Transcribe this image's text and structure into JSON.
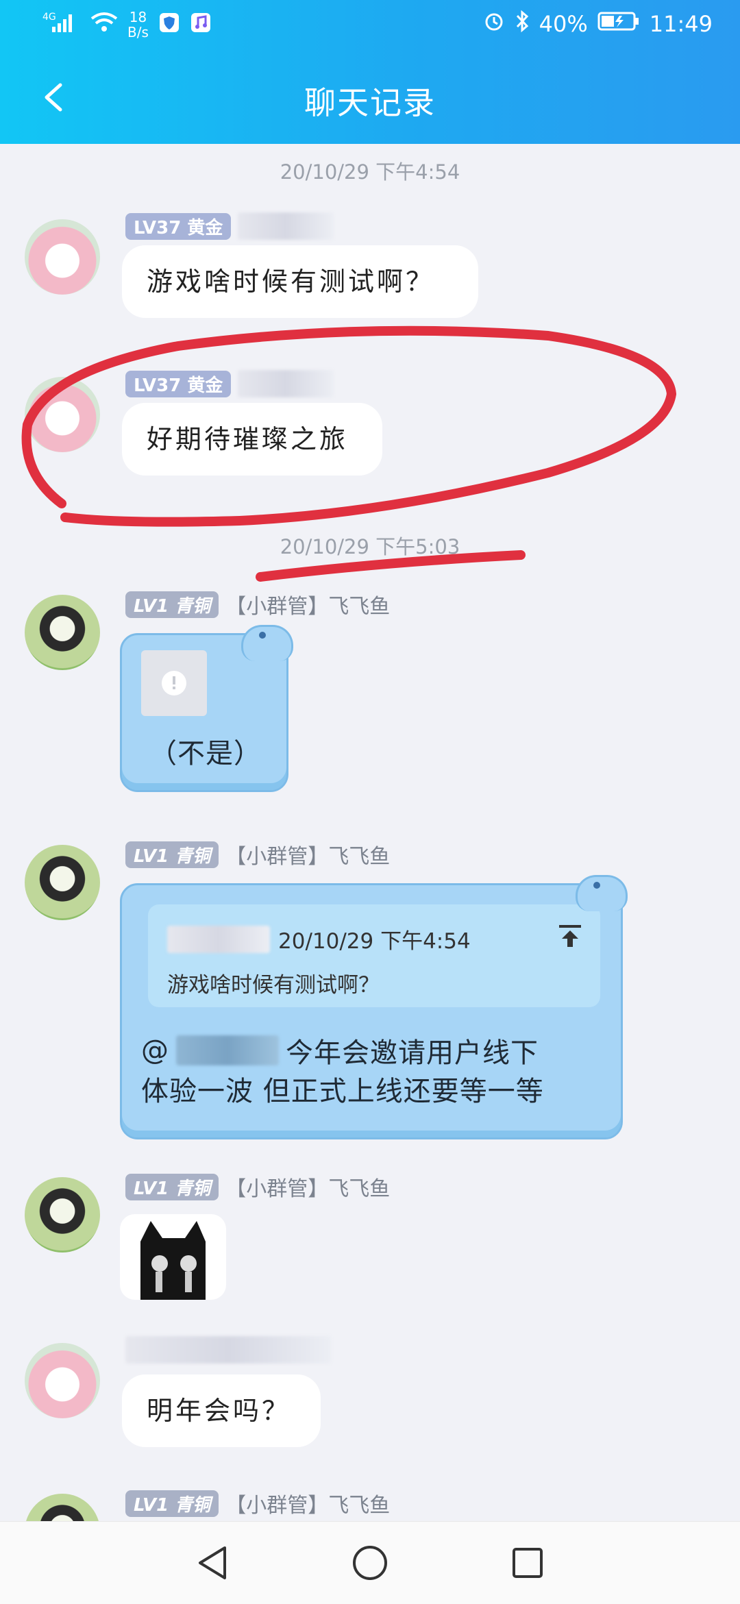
{
  "status_bar": {
    "network": "4G",
    "speed_value": "18",
    "speed_unit": "B/s",
    "battery": "40%",
    "time": "11:49"
  },
  "header": {
    "title": "聊天记录"
  },
  "timestamps": [
    "20/10/29 下午4:54",
    "20/10/29 下午5:03"
  ],
  "messages": [
    {
      "level": "LV37",
      "rank": "黄金",
      "text": "游戏啥时候有测试啊？"
    },
    {
      "level": "LV37",
      "rank": "黄金",
      "text": "好期待璀璨之旅"
    },
    {
      "level": "LV1",
      "rank": "青铜",
      "role": "【小群管】飞飞鱼",
      "text": "（不是）"
    },
    {
      "level": "LV1",
      "rank": "青铜",
      "role": "【小群管】飞飞鱼",
      "quote_time": "20/10/29 下午4:54",
      "quote_text": "游戏啥时候有测试啊？",
      "reply_line1": "今年会邀请用户线下",
      "reply_line2": "体验一波 但正式上线还要等一等"
    },
    {
      "level": "LV1",
      "rank": "青铜",
      "role": "【小群管】飞飞鱼"
    },
    {
      "text": "明年会吗？"
    },
    {
      "level": "LV1",
      "rank": "青铜",
      "role": "【小群管】飞飞鱼"
    }
  ],
  "colors": {
    "header": "#1ea9f1",
    "annotation": "#e0303f",
    "bubble_blue": "#a7d5f6"
  },
  "icons": [
    "back-icon",
    "alarm-icon",
    "bluetooth-icon",
    "battery-icon",
    "wifi-icon",
    "signal-icon",
    "upload-icon",
    "warning-icon"
  ]
}
